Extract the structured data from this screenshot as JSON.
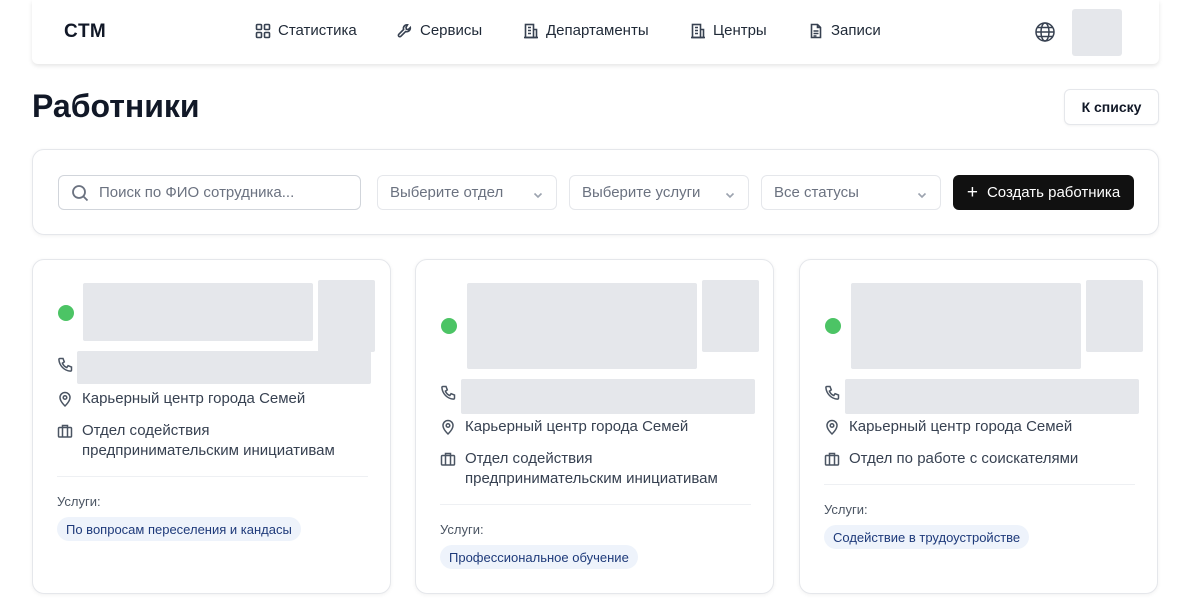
{
  "navbar": {
    "brand": "CTM",
    "items": [
      {
        "label": "Статистика",
        "icon": "grid-icon"
      },
      {
        "label": "Сервисы",
        "icon": "wrench-icon"
      },
      {
        "label": "Департаменты",
        "icon": "building-icon"
      },
      {
        "label": "Центры",
        "icon": "building-icon"
      },
      {
        "label": "Записи",
        "icon": "document-icon"
      }
    ],
    "language_icon": "globe-icon"
  },
  "page": {
    "title": "Работники",
    "back_button": "К списку"
  },
  "filters": {
    "search_placeholder": "Поиск по ФИО сотрудника...",
    "department_select": "Выберите отдел",
    "services_select": "Выберите услуги",
    "status_select": "Все статусы",
    "create_button": "Создать работника"
  },
  "colors": {
    "status_active": "#4cc465",
    "tag_background": "#eef3fb",
    "tag_text": "#1e3a7a",
    "primary_button": "#111111",
    "skeleton": "#e5e7eb"
  },
  "workers": [
    {
      "status": "active",
      "center": "Карьерный центр города Семей",
      "department": "Отдел содействия предпринимательским инициативам",
      "services_label": "Услуги:",
      "services": [
        "По вопросам переселения и кандасы"
      ]
    },
    {
      "status": "active",
      "center": "Карьерный центр города Семей",
      "department": "Отдел содействия предпринимательским инициативам",
      "services_label": "Услуги:",
      "services": [
        "Профессиональное обучение"
      ]
    },
    {
      "status": "active",
      "center": "Карьерный центр города Семей",
      "department": "Отдел по работе с соискателями",
      "services_label": "Услуги:",
      "services": [
        "Содействие в трудоустройстве"
      ]
    }
  ]
}
